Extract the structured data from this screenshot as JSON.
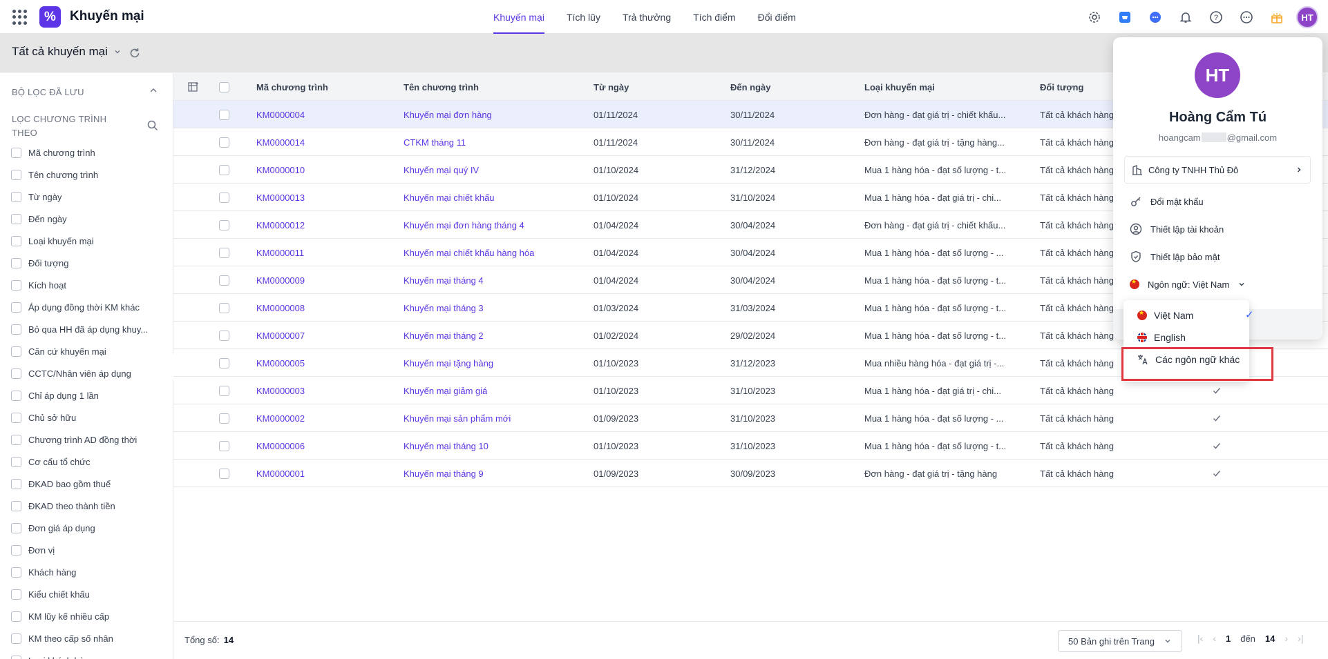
{
  "app": {
    "title": "Khuyến mại",
    "logo_glyph": "%"
  },
  "top_tabs": [
    {
      "label": "Khuyến mại",
      "active": true
    },
    {
      "label": "Tích lũy",
      "active": false
    },
    {
      "label": "Trả thưởng",
      "active": false
    },
    {
      "label": "Tích điểm",
      "active": false
    },
    {
      "label": "Đổi điểm",
      "active": false
    }
  ],
  "user": {
    "initials": "HT"
  },
  "toolbar": {
    "view_label": "Tất cả khuyến mại"
  },
  "sidebar": {
    "saved_label": "BỘ LỌC ĐÃ LƯU",
    "filter_title": "LỌC CHƯƠNG TRÌNH THEO",
    "items": [
      "Mã chương trình",
      "Tên chương trình",
      "Từ ngày",
      "Đến ngày",
      "Loại khuyến mại",
      "Đối tượng",
      "Kích hoạt",
      "Áp dụng đồng thời KM khác",
      "Bỏ qua HH đã áp dụng khuy...",
      "Căn cứ khuyến mại",
      "CCTC/Nhân viên áp dụng",
      "Chỉ áp dụng 1 lần",
      "Chủ sở hữu",
      "Chương trình AD đồng thời",
      "Cơ cấu tổ chức",
      "ĐKAD bao gồm thuế",
      "ĐKAD theo thành tiền",
      "Đơn giá áp dụng",
      "Đơn vị",
      "Khách hàng",
      "Kiểu chiết khấu",
      "KM lũy kế nhiều cấp",
      "KM theo cấp số nhân",
      "Loại khách hàng"
    ]
  },
  "table": {
    "columns": [
      "Mã chương trình",
      "Tên chương trình",
      "Từ ngày",
      "Đến ngày",
      "Loại khuyến mại",
      "Đối tượng"
    ],
    "rows": [
      {
        "code": "KM0000004",
        "name": "Khuyến mại đơn hàng",
        "from": "01/11/2024",
        "to": "30/11/2024",
        "type": "Đơn hàng - đạt giá trị - chiết khấu...",
        "target": "Tất cả khách hàng",
        "active": false,
        "selected": true
      },
      {
        "code": "KM0000014",
        "name": "CTKM tháng 11",
        "from": "01/11/2024",
        "to": "30/11/2024",
        "type": "Đơn hàng - đạt giá trị - tặng hàng...",
        "target": "Tất cả khách hàng",
        "active": false
      },
      {
        "code": "KM0000010",
        "name": "Khuyến mại quý IV",
        "from": "01/10/2024",
        "to": "31/12/2024",
        "type": "Mua 1 hàng hóa - đạt số lượng - t...",
        "target": "Tất cả khách hàng",
        "active": false
      },
      {
        "code": "KM0000013",
        "name": "Khuyến mại chiết khấu",
        "from": "01/10/2024",
        "to": "31/10/2024",
        "type": "Mua 1 hàng hóa - đạt giá trị - chi...",
        "target": "Tất cả khách hàng",
        "active": false
      },
      {
        "code": "KM0000012",
        "name": "Khuyến mại đơn hàng tháng 4",
        "from": "01/04/2024",
        "to": "30/04/2024",
        "type": "Đơn hàng - đạt giá trị - chiết khấu...",
        "target": "Tất cả khách hàng",
        "active": false
      },
      {
        "code": "KM0000011",
        "name": "Khuyến mại chiết khấu hàng hóa",
        "from": "01/04/2024",
        "to": "30/04/2024",
        "type": "Mua 1 hàng hóa - đạt số lượng - ...",
        "target": "Tất cả khách hàng",
        "active": false
      },
      {
        "code": "KM0000009",
        "name": "Khuyến mại tháng 4",
        "from": "01/04/2024",
        "to": "30/04/2024",
        "type": "Mua 1 hàng hóa - đạt số lượng - t...",
        "target": "Tất cả khách hàng",
        "active": false
      },
      {
        "code": "KM0000008",
        "name": "Khuyến mại tháng 3",
        "from": "01/03/2024",
        "to": "31/03/2024",
        "type": "Mua 1 hàng hóa - đạt số lượng - t...",
        "target": "Tất cả khách hàng",
        "active": false
      },
      {
        "code": "KM0000007",
        "name": "Khuyến mại tháng 2",
        "from": "01/02/2024",
        "to": "29/02/2024",
        "type": "Mua 1 hàng hóa - đạt số lượng - t...",
        "target": "Tất cả khách hàng",
        "active": false
      },
      {
        "code": "KM0000005",
        "name": "Khuyến mại tặng hàng",
        "from": "01/10/2023",
        "to": "31/12/2023",
        "type": "Mua nhiều hàng hóa - đạt giá trị -...",
        "target": "Tất cả khách hàng",
        "active": false
      },
      {
        "code": "KM0000003",
        "name": "Khuyến mại giảm giá",
        "from": "01/10/2023",
        "to": "31/10/2023",
        "type": "Mua 1 hàng hóa - đạt giá trị - chi...",
        "target": "Tất cả khách hàng",
        "active": true
      },
      {
        "code": "KM0000002",
        "name": "Khuyến mại sản phẩm mới",
        "from": "01/09/2023",
        "to": "31/10/2023",
        "type": "Mua 1 hàng hóa - đạt số lượng - ...",
        "target": "Tất cả khách hàng",
        "active": true
      },
      {
        "code": "KM0000006",
        "name": "Khuyến mại tháng 10",
        "from": "01/10/2023",
        "to": "31/10/2023",
        "type": "Mua 1 hàng hóa - đạt số lượng - t...",
        "target": "Tất cả khách hàng",
        "active": true
      },
      {
        "code": "KM0000001",
        "name": "Khuyến mại tháng 9",
        "from": "01/09/2023",
        "to": "30/09/2023",
        "type": "Đơn hàng - đạt giá trị - tặng hàng",
        "target": "Tất cả khách hàng",
        "active": true
      }
    ]
  },
  "footer": {
    "total_label": "Tổng số:",
    "total_value": "14",
    "page_size": "50 Bản ghi trên Trang",
    "page_from": "1",
    "page_to_label": "đến",
    "page_to": "14"
  },
  "profile": {
    "initials": "HT",
    "name": "Hoàng Cẩm Tú",
    "email_prefix": "hoangcam",
    "email_suffix": "@gmail.com",
    "company": "Công ty TNHH Thủ Đô",
    "menu": [
      "Đổi mật khẩu",
      "Thiết lập tài khoản",
      "Thiết lập bảo mật"
    ],
    "language_label": "Ngôn ngữ: Việt Nam"
  },
  "language_dropdown": {
    "options": [
      "Việt Nam",
      "English",
      "Các ngôn ngữ khác"
    ],
    "selected": "Việt Nam"
  },
  "colors": {
    "accent": "#5b35e6",
    "avatar": "#8e44c7",
    "highlight": "#e0383e",
    "selected_row": "#ebeefb"
  }
}
